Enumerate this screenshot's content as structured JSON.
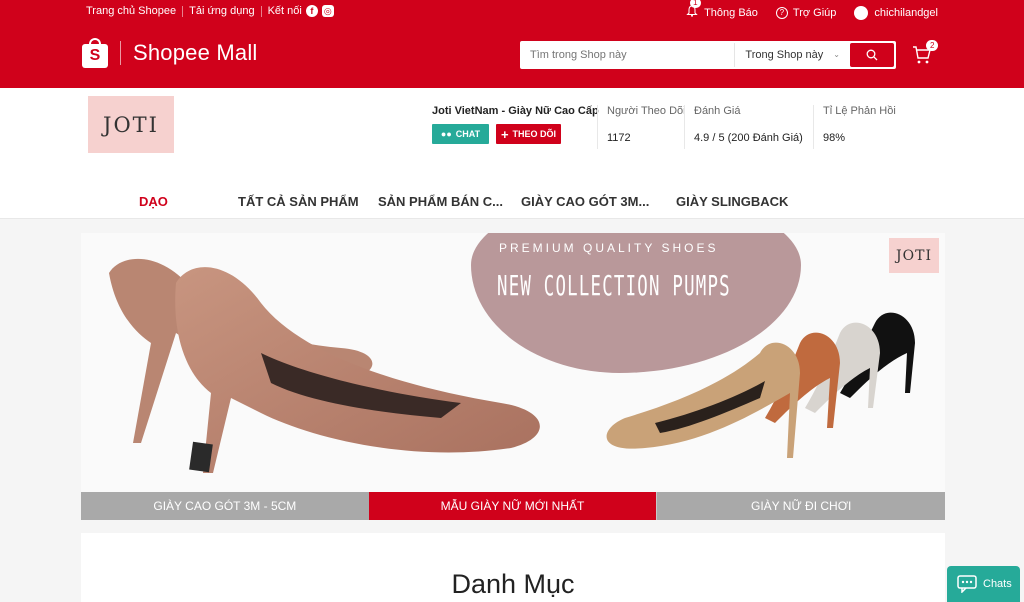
{
  "topbar": {
    "home": "Trang chủ Shopee",
    "download": "Tải ứng dụng",
    "connect": "Kết nối",
    "notifications": "Thông Báo",
    "notifications_count": "1",
    "help": "Trợ Giúp",
    "username": "chichilandgel"
  },
  "header": {
    "logo_text": "Shopee Mall",
    "search_placeholder": "Tìm trong Shop này",
    "search_scope": "Trong Shop này",
    "cart_count": "2"
  },
  "shop": {
    "logo_text": "JOTI",
    "name": "Joti VietNam - Giày Nữ Cao Cấp",
    "chat_label": "CHAT",
    "follow_label": "THEO DÕI",
    "stats": [
      {
        "label": "Người Theo Dõi",
        "value": "1172"
      },
      {
        "label": "Đánh Giá",
        "value": "4.9 / 5 (200 Đánh Giá)"
      },
      {
        "label": "Tỉ Lệ Phản Hồi",
        "value": "98%"
      }
    ],
    "nav": [
      "DẠO",
      "TẤT CẢ SẢN PHẨM",
      "SẢN PHẨM BÁN C...",
      "GIÀY CAO GÓT 3M...",
      "GIÀY SLINGBACK"
    ]
  },
  "banner": {
    "premium": "PREMIUM QUALITY SHOES",
    "headline": "NEW COLLECTION PUMPS",
    "logo_text": "JOTI",
    "tabs": [
      "GIÀY CAO GÓT 3M - 5CM",
      "MẪU GIÀY NỮ MỚI NHẤT",
      "GIÀY NỮ ĐI CHƠI"
    ],
    "active_tab": 1
  },
  "category": {
    "title": "Danh Mục"
  },
  "chats": {
    "label": "Chats"
  },
  "colors": {
    "brand": "#d0011b",
    "chat": "#26aa99"
  }
}
